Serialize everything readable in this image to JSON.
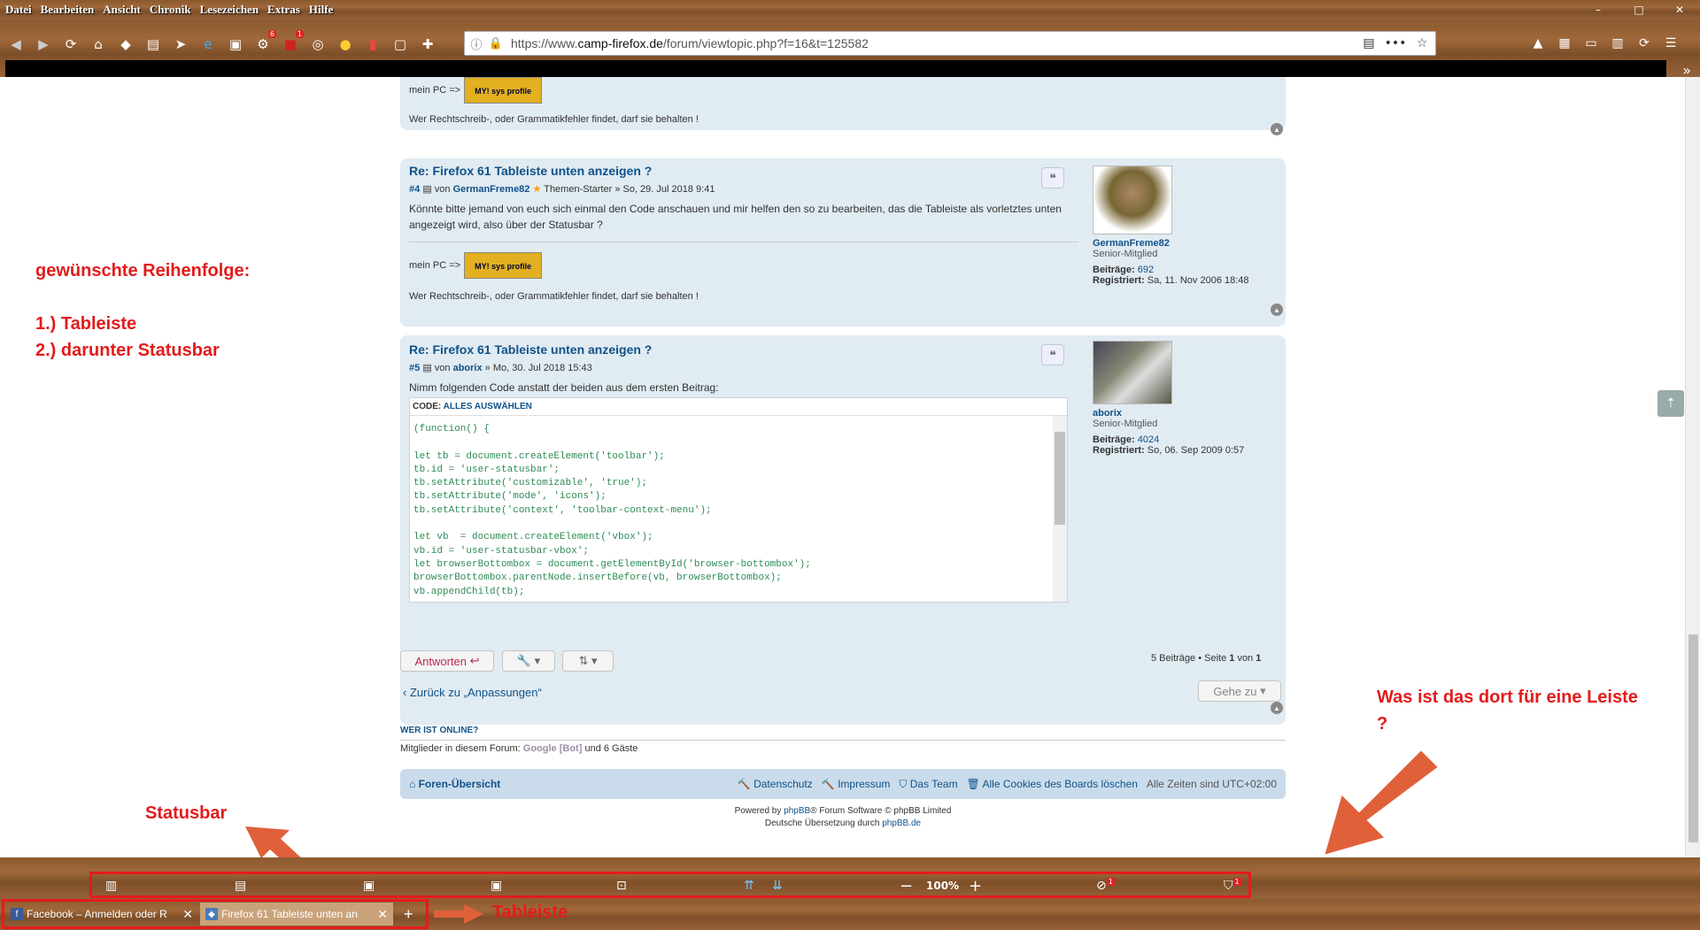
{
  "menu": [
    "Datei",
    "Bearbeiten",
    "Ansicht",
    "Chronik",
    "Lesezeichen",
    "Extras",
    "Hilfe"
  ],
  "window_controls": [
    "–",
    "□",
    "✕"
  ],
  "navbar": {
    "badges": [
      "6",
      "1"
    ],
    "url_prefix": "https://www.",
    "url_domain": "camp-firefox.de",
    "url_path": "/forum/viewtopic.php?f=16&t=125582"
  },
  "posts": [
    {
      "sig_label": "mein PC =>",
      "sig_img": "MY! sys profile",
      "footer": "Wer Rechtschreib-, oder Grammatikfehler findet, darf sie behalten !"
    },
    {
      "title": "Re: Firefox 61 Tableiste unten anzeigen ?",
      "num": "#4",
      "by": "von",
      "user": "GermanFreme82",
      "role": "Themen-Starter",
      "date": "» So, 29. Jul 2018 9:41",
      "body": "Könnte bitte jemand von euch sich einmal den Code anschauen und mir helfen den so zu bearbeiten, das die Tableiste als vorletztes unten angezeigt wird, also über der Statusbar ?",
      "sig_label": "mein PC =>",
      "sig_img": "MY! sys profile",
      "footer": "Wer Rechtschreib-, oder Grammatikfehler findet, darf sie behalten !",
      "profile": {
        "name": "GermanFreme82",
        "rank": "Senior-Mitglied",
        "posts_label": "Beiträge:",
        "posts": "692",
        "reg_label": "Registriert:",
        "reg": "Sa, 11. Nov 2006 18:48"
      }
    },
    {
      "title": "Re: Firefox 61 Tableiste unten anzeigen ?",
      "num": "#5",
      "by": "von",
      "user": "aborix",
      "date": "» Mo, 30. Jul 2018 15:43",
      "body": "Nimm folgenden Code anstatt der beiden aus dem ersten Beitrag:",
      "code_label": "CODE:",
      "code_select": "ALLES AUSWÄHLEN",
      "code": "(function() {\n\nlet tb = document.createElement('toolbar');\ntb.id = 'user-statusbar';\ntb.setAttribute('customizable', 'true');\ntb.setAttribute('mode', 'icons');\ntb.setAttribute('context', 'toolbar-context-menu');\n\nlet vb  = document.createElement('vbox');\nvb.id = 'user-statusbar-vbox';\nlet browserBottombox = document.getElementById('browser-bottombox');\nbrowserBottombox.parentNode.insertBefore(vb, browserBottombox);\nvb.appendChild(tb);",
      "profile": {
        "name": "aborix",
        "rank": "Senior-Mitglied",
        "posts_label": "Beiträge:",
        "posts": "4024",
        "reg_label": "Registriert:",
        "reg": "So, 06. Sep 2009 0:57"
      }
    }
  ],
  "actions": {
    "reply": "Antworten",
    "pagination": "5 Beiträge • Seite",
    "page": "1",
    "of": "von",
    "total": "1",
    "back": "Zurück zu „Anpassungen“",
    "goto": "Gehe zu"
  },
  "online": {
    "heading": "WER IST ONLINE?",
    "text": "Mitglieder in diesem Forum:",
    "bot": "Google [Bot]",
    "rest": "und 6 Gäste"
  },
  "footer": {
    "index": "Foren-Übersicht",
    "privacy": "Datenschutz",
    "impressum": "Impressum",
    "team": "Das Team",
    "cookies": "Alle Cookies des Boards löschen",
    "timezone": "Alle Zeiten sind UTC+02:00",
    "powered1": "Powered by",
    "phpbb": "phpBB",
    "powered2": "® Forum Software © phpBB Limited",
    "translation": "Deutsche Übersetzung durch",
    "phpbbde": "phpBB.de"
  },
  "annotations": {
    "order_title": "gewünschte Reihenfolge:",
    "order_1": "1.) Tableiste",
    "order_2": "2.) darunter Statusbar",
    "question": "Was ist das dort für eine Leiste ?",
    "statusbar": "Statusbar",
    "tableiste": "Tableiste"
  },
  "statusbar": {
    "zoom": "100%",
    "badge1": "1",
    "badge2": "1"
  },
  "tabs": [
    {
      "title": "Facebook – Anmelden oder R"
    },
    {
      "title": "Firefox 61 Tableiste unten an"
    }
  ],
  "colors": {
    "annotation": "#e41b1b",
    "link": "#105289",
    "post_bg": "#e1ebf2"
  }
}
